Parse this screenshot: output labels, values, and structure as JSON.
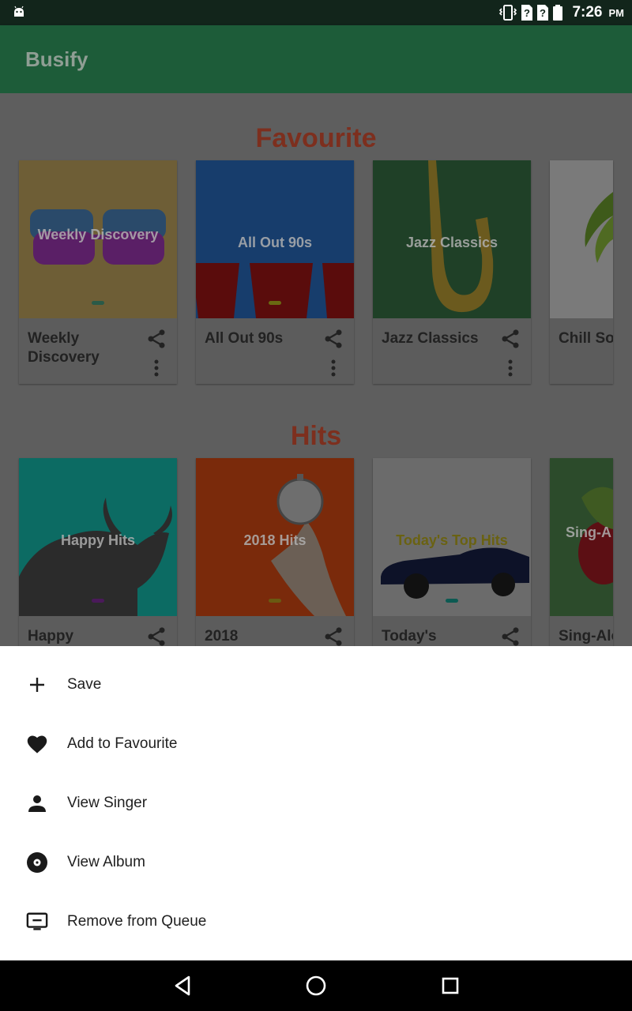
{
  "status_bar": {
    "time": "7:26",
    "ampm": "PM",
    "icons": [
      "android-icon",
      "vibrate-icon",
      "no-sim-icon",
      "no-sim-icon",
      "battery-icon"
    ]
  },
  "app": {
    "title": "Busify",
    "primary_color": "#1d5c39",
    "accent_color": "#c0392b"
  },
  "sections": [
    {
      "title": "Favourite",
      "cards": [
        {
          "name": "Weekly Discovery",
          "art_label": "Weekly Discovery",
          "art_color": "#6e5e36"
        },
        {
          "name": "All Out 90s",
          "art_label": "All Out 90s",
          "art_color": "#173d6c"
        },
        {
          "name": "Jazz Classics",
          "art_label": "Jazz Classics",
          "art_color": "#1f4027"
        },
        {
          "name": "Chill Songs",
          "art_label": "",
          "art_color": "#7a7a7a"
        }
      ]
    },
    {
      "title": "Hits",
      "cards": [
        {
          "name": "Happy",
          "art_label": "Happy Hits",
          "art_color": "#0c6b63"
        },
        {
          "name": "2018",
          "art_label": "2018 Hits",
          "art_color": "#7a2a0b"
        },
        {
          "name": "Today's",
          "art_label": "Today's Top Hits",
          "art_color": "#6b6b6b"
        },
        {
          "name": "Sing-Alo",
          "art_label": "Sing-A",
          "art_color": "#2c4b2b"
        }
      ]
    }
  ],
  "sheet": {
    "items": [
      {
        "label": "Save",
        "icon": "plus-icon"
      },
      {
        "label": "Add to Favourite",
        "icon": "heart-icon"
      },
      {
        "label": "View Singer",
        "icon": "person-icon"
      },
      {
        "label": "View Album",
        "icon": "album-icon"
      },
      {
        "label": "Remove from Queue",
        "icon": "remove-queue-icon"
      }
    ]
  },
  "nav_bar": {
    "buttons": [
      "back-icon",
      "home-icon",
      "recents-icon"
    ]
  }
}
